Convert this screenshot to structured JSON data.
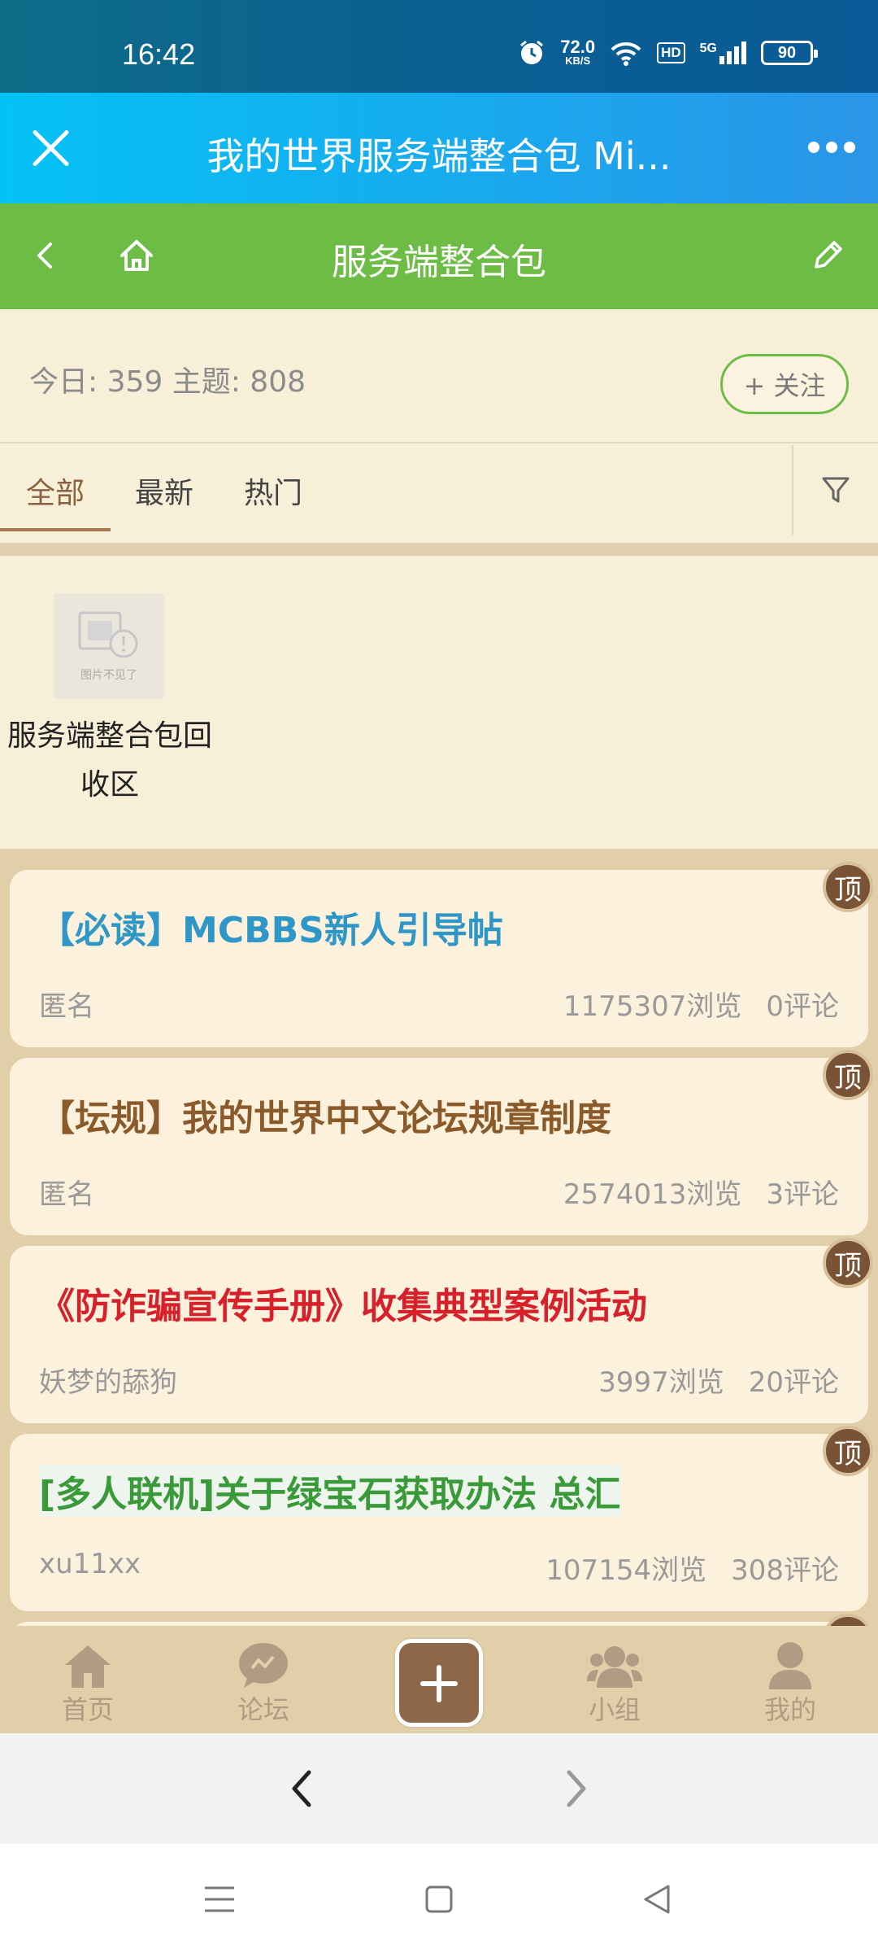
{
  "status_bar": {
    "time": "16:42",
    "net_speed": "72.0",
    "net_speed_unit": "KB/S",
    "hd": "HD",
    "network": "5G",
    "battery": "90"
  },
  "title_bar": {
    "title": "我的世界服务端整合包 Mi..."
  },
  "forum_nav": {
    "title": "服务端整合包"
  },
  "forum_stats": {
    "text": "今日: 359 主题: 808",
    "follow_label": "+ 关注"
  },
  "tabs": [
    {
      "label": "全部",
      "active": true
    },
    {
      "label": "最新",
      "active": false
    },
    {
      "label": "热门",
      "active": false
    }
  ],
  "subforum": {
    "thumb_caption": "图片不见了",
    "name": "服务端整合包回收区"
  },
  "posts": [
    {
      "title": "【必读】MCBBS新人引导帖",
      "author": "匿名",
      "views": "1175307浏览",
      "comments": "0评论",
      "color": "#2f96c8",
      "pin": "顶"
    },
    {
      "title": "【坛规】我的世界中文论坛规章制度",
      "author": "匿名",
      "views": "2574013浏览",
      "comments": "3评论",
      "color": "#8b5a2b",
      "pin": "顶"
    },
    {
      "title": "《防诈骗宣传手册》收集典型案例活动",
      "author": "妖梦的舔狗",
      "views": "3997浏览",
      "comments": "20评论",
      "color": "#d8202a",
      "pin": "顶"
    },
    {
      "title": "[多人联机]关于绿宝石获取办法 总汇",
      "author": "xu11xx",
      "views": "107154浏览",
      "comments": "308评论",
      "color": "#3a9a3a",
      "pin": "顶"
    }
  ],
  "bottom_tabs": [
    {
      "label": "首页",
      "icon": "home-icon"
    },
    {
      "label": "论坛",
      "icon": "forum-chat-icon"
    },
    {
      "label": "小组",
      "icon": "group-icon"
    },
    {
      "label": "我的",
      "icon": "profile-icon"
    }
  ]
}
